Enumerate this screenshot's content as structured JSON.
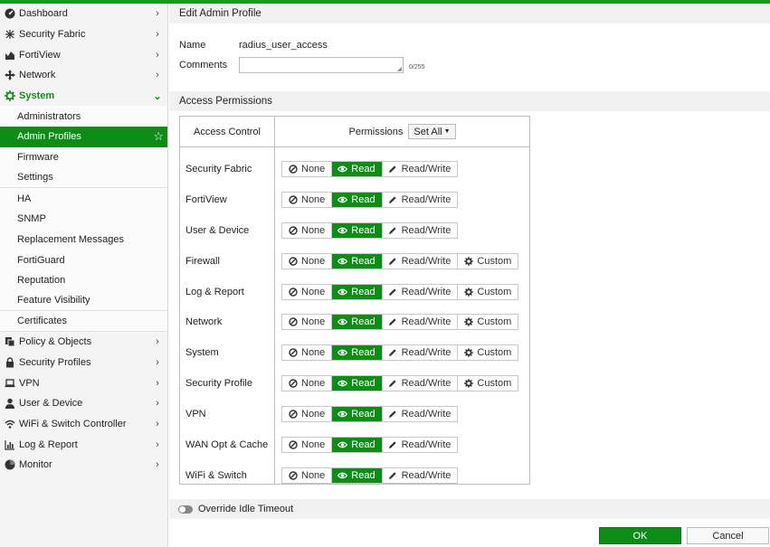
{
  "colors": {
    "accent": "#0e8c17",
    "topbar": "#1a9a1a"
  },
  "sidebar": {
    "top_items": [
      {
        "label": "Dashboard",
        "icon": "dashboard-icon"
      },
      {
        "label": "Security Fabric",
        "icon": "fabric-icon"
      },
      {
        "label": "FortiView",
        "icon": "chart-icon"
      },
      {
        "label": "Network",
        "icon": "network-icon"
      }
    ],
    "system": {
      "label": "System",
      "icon": "gear-icon"
    },
    "system_children": [
      "Administrators",
      "Admin Profiles",
      "Firmware",
      "Settings",
      "HA",
      "SNMP",
      "Replacement Messages",
      "FortiGuard",
      "Reputation",
      "Feature Visibility",
      "Certificates"
    ],
    "bottom_items": [
      {
        "label": "Policy & Objects",
        "icon": "policy-icon"
      },
      {
        "label": "Security Profiles",
        "icon": "lock-icon"
      },
      {
        "label": "VPN",
        "icon": "laptop-icon"
      },
      {
        "label": "User & Device",
        "icon": "user-icon"
      },
      {
        "label": "WiFi & Switch Controller",
        "icon": "wifi-icon"
      },
      {
        "label": "Log & Report",
        "icon": "bar-chart-icon"
      },
      {
        "label": "Monitor",
        "icon": "pie-icon"
      }
    ]
  },
  "page": {
    "title": "Edit Admin Profile",
    "name_label": "Name",
    "name_value": "radius_user_access",
    "comments_label": "Comments",
    "comments_value": "",
    "comments_counter": "0/255",
    "access_permissions": "Access Permissions",
    "col_access_control": "Access Control",
    "col_permissions": "Permissions",
    "set_all": "Set All",
    "btn_none": "None",
    "btn_read": "Read",
    "btn_readwrite": "Read/Write",
    "btn_custom": "Custom",
    "override_label": "Override Idle Timeout",
    "ok": "OK",
    "cancel": "Cancel"
  },
  "permissions": [
    {
      "label": "Security Fabric",
      "selected": "Read",
      "custom": false
    },
    {
      "label": "FortiView",
      "selected": "Read",
      "custom": false
    },
    {
      "label": "User & Device",
      "selected": "Read",
      "custom": false
    },
    {
      "label": "Firewall",
      "selected": "Read",
      "custom": true
    },
    {
      "label": "Log & Report",
      "selected": "Read",
      "custom": true
    },
    {
      "label": "Network",
      "selected": "Read",
      "custom": true
    },
    {
      "label": "System",
      "selected": "Read",
      "custom": true
    },
    {
      "label": "Security Profile",
      "selected": "Read",
      "custom": true
    },
    {
      "label": "VPN",
      "selected": "Read",
      "custom": false
    },
    {
      "label": "WAN Opt & Cache",
      "selected": "Read",
      "custom": false
    },
    {
      "label": "WiFi & Switch",
      "selected": "Read",
      "custom": false
    }
  ]
}
